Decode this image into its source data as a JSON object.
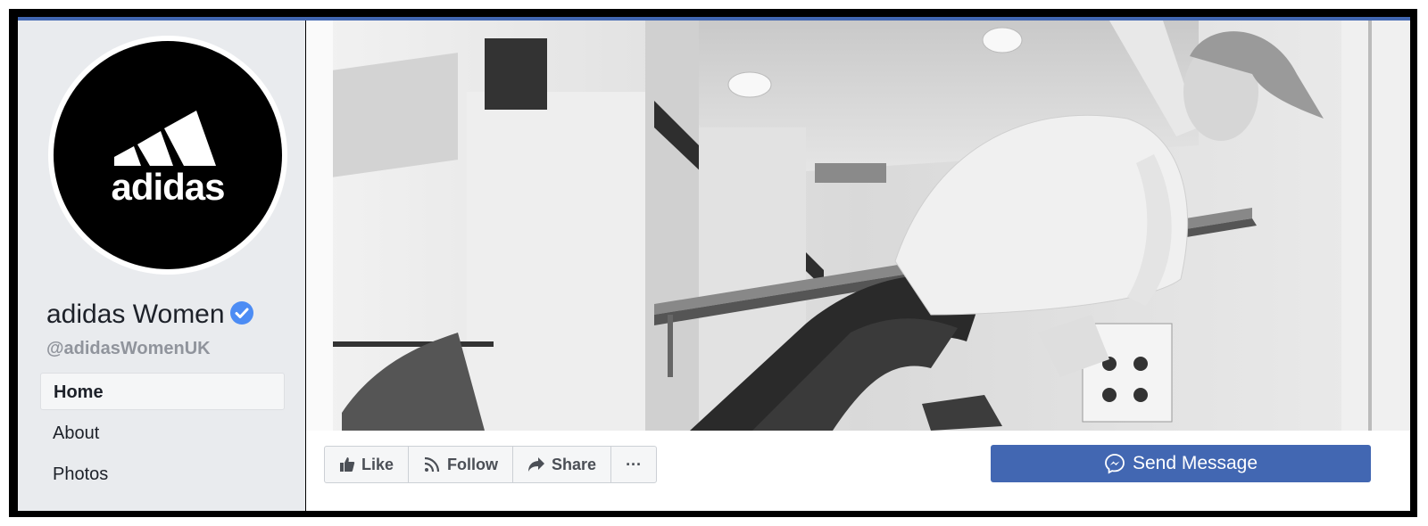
{
  "page": {
    "name": "adidas Women",
    "handle": "@adidasWomenUK",
    "logo_text": "adidas",
    "verified": true
  },
  "nav": {
    "items": [
      {
        "label": "Home",
        "active": true
      },
      {
        "label": "About",
        "active": false
      },
      {
        "label": "Photos",
        "active": false
      }
    ]
  },
  "actions": {
    "like_label": "Like",
    "follow_label": "Follow",
    "share_label": "Share",
    "more_label": "···",
    "send_message_label": "Send Message"
  },
  "colors": {
    "brand_blue": "#4267b2",
    "verified_blue": "#4c8cf4",
    "sidebar_bg": "#e9ebee"
  },
  "icons": {
    "like": "thumbs-up-icon",
    "follow": "rss-icon",
    "share": "share-arrow-icon",
    "send": "messenger-icon",
    "verified": "verified-check-icon"
  }
}
